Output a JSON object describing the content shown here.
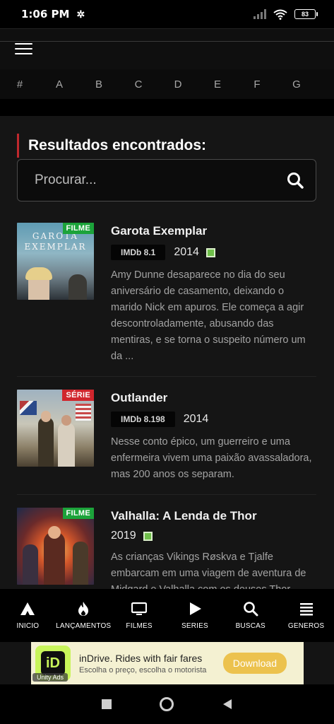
{
  "status": {
    "time": "1:06 PM",
    "battery": "83"
  },
  "alphabet": [
    "#",
    "A",
    "B",
    "C",
    "D",
    "E",
    "F",
    "G"
  ],
  "results_heading": "Resultados encontrados:",
  "search": {
    "placeholder": "Procurar..."
  },
  "items": [
    {
      "badge": "FILME",
      "title": "Garota Exemplar",
      "imdb": "IMDb 8.1",
      "year": "2014",
      "description": "Amy Dunne desaparece no dia do seu aniversário de casamento, deixando o marido Nick em apuros. Ele começa a agir descontroladamente, abusando das mentiras, e se torna o suspeito número um da ...",
      "poster_text": "GAROTA EXEMPLAR"
    },
    {
      "badge": "SÉRIE",
      "title": "Outlander",
      "imdb": "IMDb 8.198",
      "year": "2014",
      "description": "Nesse conto épico, um guerreiro e uma enfermeira vivem uma paixão avassaladora, mas 200 anos os separam."
    },
    {
      "badge": "FILME",
      "title": "Valhalla: A Lenda de Thor",
      "year": "2019",
      "description": "As crianças Vikings Røskva e Tjalfe embarcam em uma viagem de aventura de Midgard e Valhalla com os deuses Thor"
    }
  ],
  "nav": [
    "INICIO",
    "LANÇAMENTOS",
    "FILMES",
    "SERIES",
    "BUSCAS",
    "GENEROS"
  ],
  "ad": {
    "title": "inDrive. Rides with fair fares",
    "subtitle": "Escolha o preço, escolha o motorista",
    "button": "Download",
    "logo": "iD",
    "tag": "Unity Ads"
  },
  "colors": {
    "accent": "#c0282d",
    "filme": "#1ca33a",
    "serie": "#d0262d"
  }
}
